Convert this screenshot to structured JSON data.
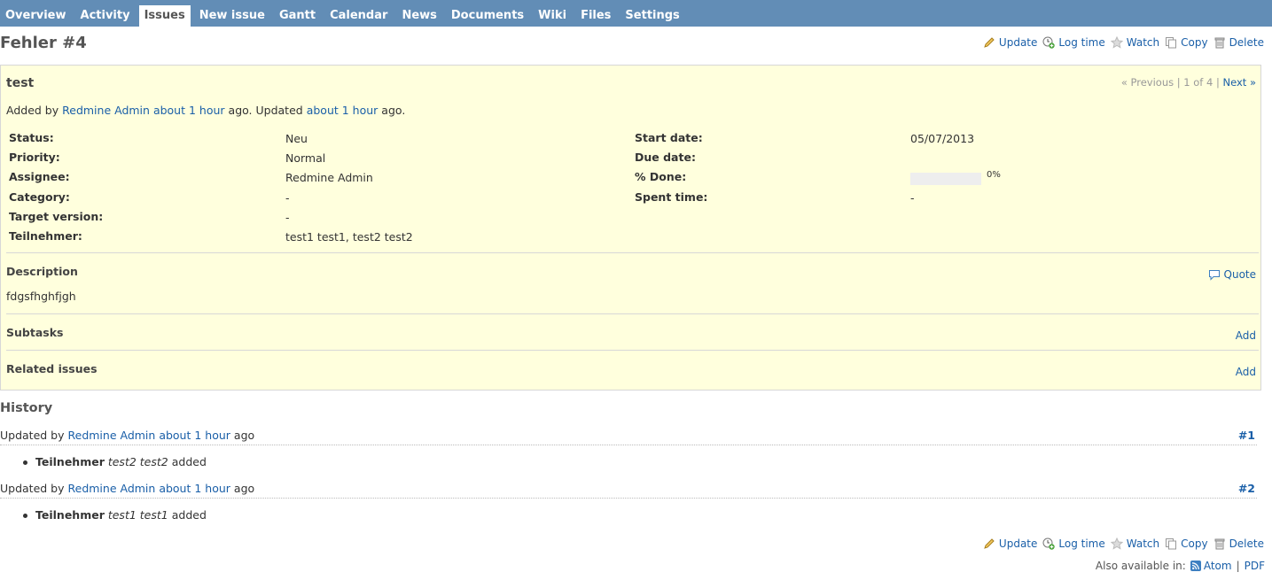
{
  "tabs": [
    "Overview",
    "Activity",
    "Issues",
    "New issue",
    "Gantt",
    "Calendar",
    "News",
    "Documents",
    "Wiki",
    "Files",
    "Settings"
  ],
  "selected_tab": "Issues",
  "page_title": "Fehler #4",
  "actions": {
    "update": "Update",
    "log_time": "Log time",
    "watch": "Watch",
    "copy": "Copy",
    "delete": "Delete"
  },
  "issue": {
    "subject": "test",
    "nav": {
      "previous": "« Previous",
      "sep1": "|",
      "position": "1 of 4",
      "sep2": "|",
      "next": "Next »"
    },
    "author_line": {
      "added_by": "Added by",
      "author": "Redmine Admin",
      "added_time": "about 1 hour",
      "ago_updated": "ago. Updated",
      "updated_time": "about 1 hour",
      "ago": "ago."
    },
    "attributes": {
      "status_label": "Status:",
      "status": "Neu",
      "priority_label": "Priority:",
      "priority": "Normal",
      "assignee_label": "Assignee:",
      "assignee": "Redmine Admin",
      "category_label": "Category:",
      "category": "-",
      "target_version_label": "Target version:",
      "target_version": "-",
      "teilnehmer_label": "Teilnehmer:",
      "teilnehmer": "test1 test1, test2 test2",
      "start_date_label": "Start date:",
      "start_date": "05/07/2013",
      "due_date_label": "Due date:",
      "due_date": "",
      "done_label": "% Done:",
      "done_text": "0%",
      "done_ratio": 0,
      "spent_time_label": "Spent time:",
      "spent_time": "-"
    },
    "description_title": "Description",
    "quote": "Quote",
    "description": "fdgsfhghfjgh",
    "subtasks_title": "Subtasks",
    "subtasks_add": "Add",
    "related_title": "Related issues",
    "related_add": "Add"
  },
  "history": {
    "title": "History",
    "journals": [
      {
        "updated_by": "Updated by",
        "author": "Redmine Admin",
        "time": "about 1 hour",
        "ago": "ago",
        "index": "#1",
        "field": "Teilnehmer",
        "value": "test2 test2",
        "action": "added"
      },
      {
        "updated_by": "Updated by",
        "author": "Redmine Admin",
        "time": "about 1 hour",
        "ago": "ago",
        "index": "#2",
        "field": "Teilnehmer",
        "value": "test1 test1",
        "action": "added"
      }
    ]
  },
  "footer": {
    "also_available": "Also available in:",
    "atom": "Atom",
    "sep": "|",
    "pdf": "PDF"
  },
  "colors": {
    "header": "#628db6",
    "issue_bg": "#ffffdd",
    "link": "#1a5fa8"
  }
}
